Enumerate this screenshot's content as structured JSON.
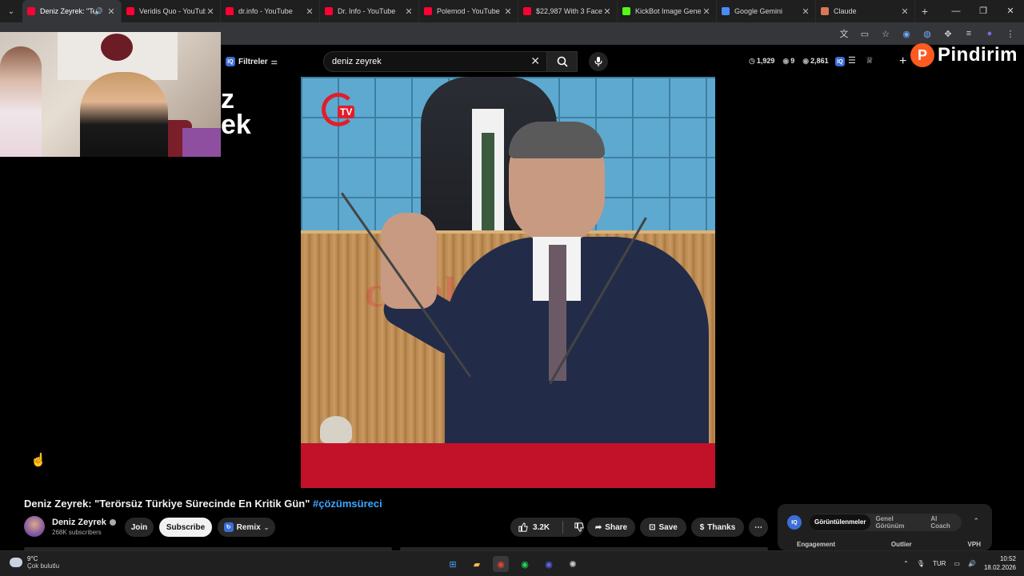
{
  "browser": {
    "tabs": [
      {
        "label": "Deniz Zeyrek: \"Te",
        "color": "#ff0033",
        "active": true
      },
      {
        "label": "Veridis Quo - YouTub",
        "color": "#ff0033"
      },
      {
        "label": "dr.info - YouTube",
        "color": "#ff0033"
      },
      {
        "label": "Dr. Info - YouTube",
        "color": "#ff0033"
      },
      {
        "label": "Polemod - YouTube",
        "color": "#ff0033"
      },
      {
        "label": "$22,987 With 3 Facel",
        "color": "#ff0033"
      },
      {
        "label": "KickBot Image Gener",
        "color": "#53fc18"
      },
      {
        "label": "Google Gemini",
        "color": "#4a8cf7"
      },
      {
        "label": "Claude",
        "color": "#d97757"
      }
    ]
  },
  "youtube": {
    "filter_label": "Filtreler",
    "search_value": "deniz zeyrek",
    "stats": {
      "time": "1,929",
      "views_small": "9",
      "viewers": "2,861"
    },
    "brand": "Pindirim",
    "brand_letter": "P",
    "overlay_text": "z\nek",
    "video_channel_badge": "TV",
    "video_watermark": "cumhuriyet"
  },
  "video": {
    "title": "Deniz Zeyrek: \"Terörsüz Türkiye Sürecinde En Kritik Gün\"",
    "hashtag": "#çözümsüreci",
    "channel_name": "Deniz Zeyrek",
    "subscribers": "268K subscribers",
    "join_label": "Join",
    "subscribe_label": "Subscribe",
    "remix_label": "Remix",
    "like_count": "3.2K",
    "share_label": "Share",
    "save_label": "Save",
    "thanks_label": "Thanks"
  },
  "iq_panel": {
    "logo": "IQ",
    "tabs": [
      "Görüntülenmeler",
      "Genel Görünüm",
      "AI Coach"
    ],
    "columns": [
      "Engagement",
      "Outlier",
      "VPH"
    ]
  },
  "taskbar": {
    "temp": "9°C",
    "weather": "Çok bulutlu",
    "lang": "TUR",
    "time": "10:52",
    "date": "18.02.2026"
  }
}
